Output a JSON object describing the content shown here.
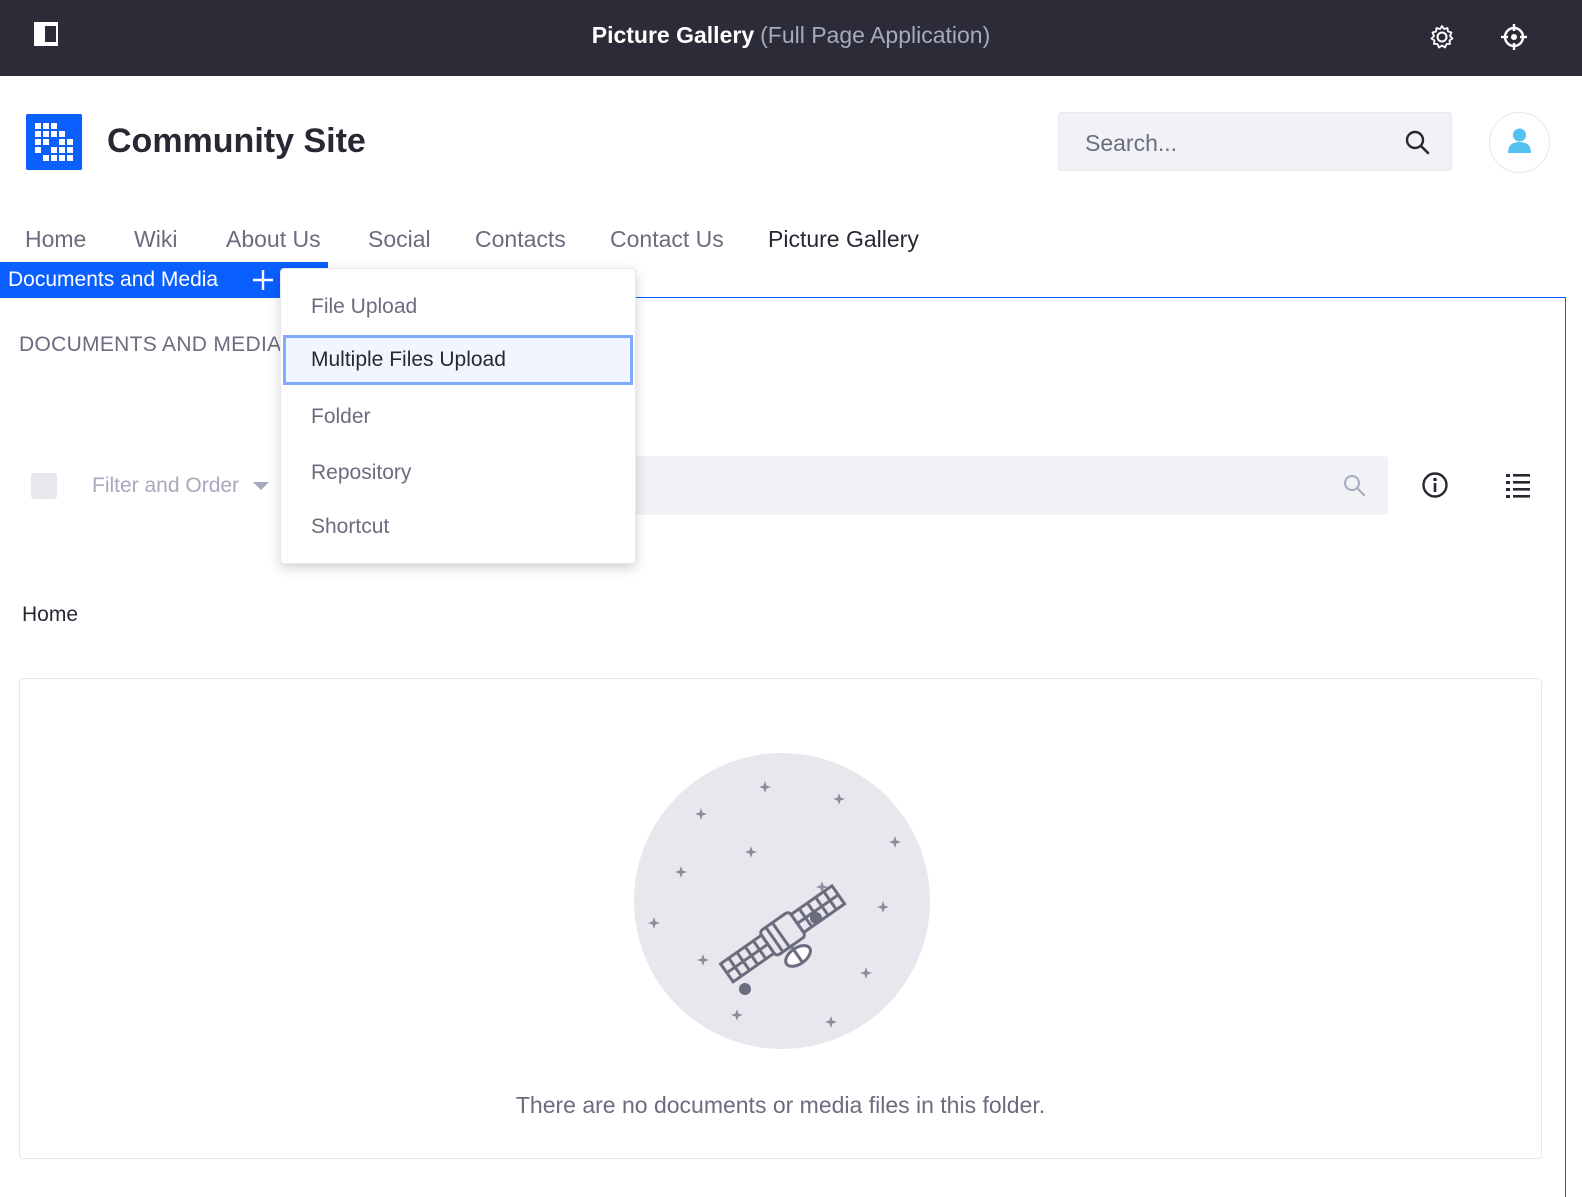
{
  "control_bar": {
    "title": "Picture Gallery",
    "subtitle": "(Full Page Application)",
    "sidebar_toggle_icon": "sidebar-toggle-icon",
    "settings_icon": "gear-icon",
    "simulation_icon": "target-icon"
  },
  "site": {
    "name": "Community Site",
    "logo_icon": "grid-logo-icon",
    "brand_color": "#0b5fff"
  },
  "search": {
    "placeholder": "Search..."
  },
  "nav": {
    "items": [
      "Home",
      "Wiki",
      "About Us",
      "Social",
      "Contacts",
      "Contact Us",
      "Picture Gallery"
    ],
    "active": "Picture Gallery"
  },
  "portlet": {
    "title": "Documents and Media",
    "section_heading": "DOCUMENTS AND MEDIA",
    "add_icon": "plus-icon"
  },
  "toolbar": {
    "filter_label": "Filter and Order",
    "info_icon": "info-icon",
    "view_icon": "list-view-icon"
  },
  "breadcrumb": {
    "home": "Home"
  },
  "empty_state": {
    "message": "There are no documents or media files in this folder.",
    "illustration": "satellite-illustration"
  },
  "add_menu": {
    "items": [
      "File Upload",
      "Multiple Files Upload",
      "Folder",
      "Repository",
      "Shortcut"
    ],
    "focused": "Multiple Files Upload"
  }
}
